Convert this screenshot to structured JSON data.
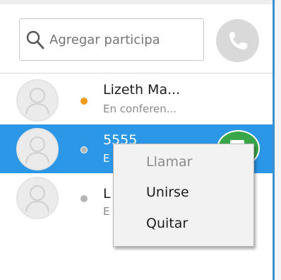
{
  "search": {
    "placeholder": "Agregar participa"
  },
  "participants": [
    {
      "name": "Lizeth Ma...",
      "status": "En conferen...",
      "presence_color": "#f09a1e",
      "selected": false
    },
    {
      "name": "5555",
      "status": "E",
      "presence_color": "#b5b5b5",
      "selected": true
    },
    {
      "name": "L",
      "status": "E",
      "presence_color": "#b5b5b5",
      "selected": false
    }
  ],
  "context_menu": {
    "items": [
      {
        "label": "Llamar",
        "enabled": false
      },
      {
        "label": "Unirse",
        "enabled": true
      },
      {
        "label": "Quitar",
        "enabled": true
      }
    ]
  },
  "colors": {
    "selection": "#2b97e6",
    "action_button": "#3aa64a",
    "call_button": "#d9d9d9"
  },
  "icons": {
    "search": "search-icon",
    "call": "phone-icon",
    "avatar": "person-icon",
    "action": "conference-call-icon"
  }
}
